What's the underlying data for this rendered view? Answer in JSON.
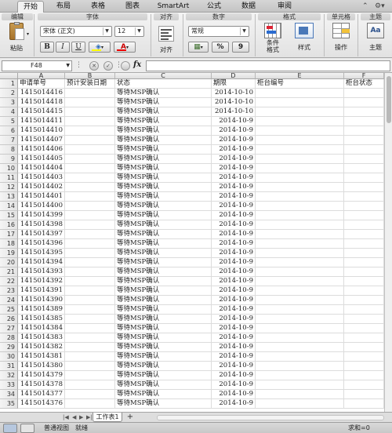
{
  "ribbon_tabs": [
    "开始",
    "布局",
    "表格",
    "图表",
    "SmartArt",
    "公式",
    "数据",
    "审阅"
  ],
  "groups": {
    "edit": "编辑",
    "font": "字体",
    "align": "对齐",
    "number": "数字",
    "format": "格式",
    "cells": "单元格",
    "theme": "主题"
  },
  "buttons": {
    "paste": "粘贴",
    "align": "对齐",
    "conditional_format": "条件\n格式",
    "style": "样式",
    "actions": "操作",
    "theme": "主题",
    "bold": "B",
    "italic": "I",
    "underline": "U",
    "percent": "%",
    "comma": "9"
  },
  "font": {
    "name": "宋体 (正文)",
    "size": "12"
  },
  "number_format": "常规",
  "formula_bar": {
    "name_box": "F48",
    "fx": "fx",
    "formula": ""
  },
  "columns": [
    "A",
    "B",
    "C",
    "D",
    "E",
    "F"
  ],
  "rows": [
    {
      "n": "1",
      "a": "申请单号",
      "b": "预计安装日期",
      "c": "状态",
      "d": "期限",
      "e": "柜台编号",
      "f": "柜台状态"
    },
    {
      "n": "2",
      "a": "1415014416",
      "b": "",
      "c": "等待MSP确认",
      "d": "2014-10-10",
      "e": "",
      "f": ""
    },
    {
      "n": "3",
      "a": "1415014418",
      "b": "",
      "c": "等待MSP确认",
      "d": "2014-10-10",
      "e": "",
      "f": ""
    },
    {
      "n": "4",
      "a": "1415014415",
      "b": "",
      "c": "等待MSP确认",
      "d": "2014-10-10",
      "e": "",
      "f": ""
    },
    {
      "n": "5",
      "a": "1415014411",
      "b": "",
      "c": "等待MSP确认",
      "d": "2014-10-9",
      "e": "",
      "f": ""
    },
    {
      "n": "6",
      "a": "1415014410",
      "b": "",
      "c": "等待MSP确认",
      "d": "2014-10-9",
      "e": "",
      "f": ""
    },
    {
      "n": "7",
      "a": "1415014407",
      "b": "",
      "c": "等待MSP确认",
      "d": "2014-10-9",
      "e": "",
      "f": ""
    },
    {
      "n": "8",
      "a": "1415014406",
      "b": "",
      "c": "等待MSP确认",
      "d": "2014-10-9",
      "e": "",
      "f": ""
    },
    {
      "n": "9",
      "a": "1415014405",
      "b": "",
      "c": "等待MSP确认",
      "d": "2014-10-9",
      "e": "",
      "f": ""
    },
    {
      "n": "10",
      "a": "1415014404",
      "b": "",
      "c": "等待MSP确认",
      "d": "2014-10-9",
      "e": "",
      "f": ""
    },
    {
      "n": "11",
      "a": "1415014403",
      "b": "",
      "c": "等待MSP确认",
      "d": "2014-10-9",
      "e": "",
      "f": ""
    },
    {
      "n": "12",
      "a": "1415014402",
      "b": "",
      "c": "等待MSP确认",
      "d": "2014-10-9",
      "e": "",
      "f": ""
    },
    {
      "n": "13",
      "a": "1415014401",
      "b": "",
      "c": "等待MSP确认",
      "d": "2014-10-9",
      "e": "",
      "f": ""
    },
    {
      "n": "14",
      "a": "1415014400",
      "b": "",
      "c": "等待MSP确认",
      "d": "2014-10-9",
      "e": "",
      "f": ""
    },
    {
      "n": "15",
      "a": "1415014399",
      "b": "",
      "c": "等待MSP确认",
      "d": "2014-10-9",
      "e": "",
      "f": ""
    },
    {
      "n": "16",
      "a": "1415014398",
      "b": "",
      "c": "等待MSP确认",
      "d": "2014-10-9",
      "e": "",
      "f": ""
    },
    {
      "n": "17",
      "a": "1415014397",
      "b": "",
      "c": "等待MSP确认",
      "d": "2014-10-9",
      "e": "",
      "f": ""
    },
    {
      "n": "18",
      "a": "1415014396",
      "b": "",
      "c": "等待MSP确认",
      "d": "2014-10-9",
      "e": "",
      "f": ""
    },
    {
      "n": "19",
      "a": "1415014395",
      "b": "",
      "c": "等待MSP确认",
      "d": "2014-10-9",
      "e": "",
      "f": ""
    },
    {
      "n": "20",
      "a": "1415014394",
      "b": "",
      "c": "等待MSP确认",
      "d": "2014-10-9",
      "e": "",
      "f": ""
    },
    {
      "n": "21",
      "a": "1415014393",
      "b": "",
      "c": "等待MSP确认",
      "d": "2014-10-9",
      "e": "",
      "f": ""
    },
    {
      "n": "22",
      "a": "1415014392",
      "b": "",
      "c": "等待MSP确认",
      "d": "2014-10-9",
      "e": "",
      "f": ""
    },
    {
      "n": "23",
      "a": "1415014391",
      "b": "",
      "c": "等待MSP确认",
      "d": "2014-10-9",
      "e": "",
      "f": ""
    },
    {
      "n": "24",
      "a": "1415014390",
      "b": "",
      "c": "等待MSP确认",
      "d": "2014-10-9",
      "e": "",
      "f": ""
    },
    {
      "n": "25",
      "a": "1415014389",
      "b": "",
      "c": "等待MSP确认",
      "d": "2014-10-9",
      "e": "",
      "f": ""
    },
    {
      "n": "26",
      "a": "1415014385",
      "b": "",
      "c": "等待MSP确认",
      "d": "2014-10-9",
      "e": "",
      "f": ""
    },
    {
      "n": "27",
      "a": "1415014384",
      "b": "",
      "c": "等待MSP确认",
      "d": "2014-10-9",
      "e": "",
      "f": ""
    },
    {
      "n": "28",
      "a": "1415014383",
      "b": "",
      "c": "等待MSP确认",
      "d": "2014-10-9",
      "e": "",
      "f": ""
    },
    {
      "n": "29",
      "a": "1415014382",
      "b": "",
      "c": "等待MSP确认",
      "d": "2014-10-9",
      "e": "",
      "f": ""
    },
    {
      "n": "30",
      "a": "1415014381",
      "b": "",
      "c": "等待MSP确认",
      "d": "2014-10-9",
      "e": "",
      "f": ""
    },
    {
      "n": "31",
      "a": "1415014380",
      "b": "",
      "c": "等待MSP确认",
      "d": "2014-10-9",
      "e": "",
      "f": ""
    },
    {
      "n": "32",
      "a": "1415014379",
      "b": "",
      "c": "等待MSP确认",
      "d": "2014-10-9",
      "e": "",
      "f": ""
    },
    {
      "n": "33",
      "a": "1415014378",
      "b": "",
      "c": "等待MSP确认",
      "d": "2014-10-9",
      "e": "",
      "f": ""
    },
    {
      "n": "34",
      "a": "1415014377",
      "b": "",
      "c": "等待MSP确认",
      "d": "2014-10-9",
      "e": "",
      "f": ""
    },
    {
      "n": "35",
      "a": "1415014376",
      "b": "",
      "c": "等待MSP确认",
      "d": "2014-10-9",
      "e": "",
      "f": ""
    }
  ],
  "sheet_tabs": [
    "工作表1"
  ],
  "status": {
    "view": "普通视图",
    "state": "就绪",
    "sum": "求和=0"
  }
}
